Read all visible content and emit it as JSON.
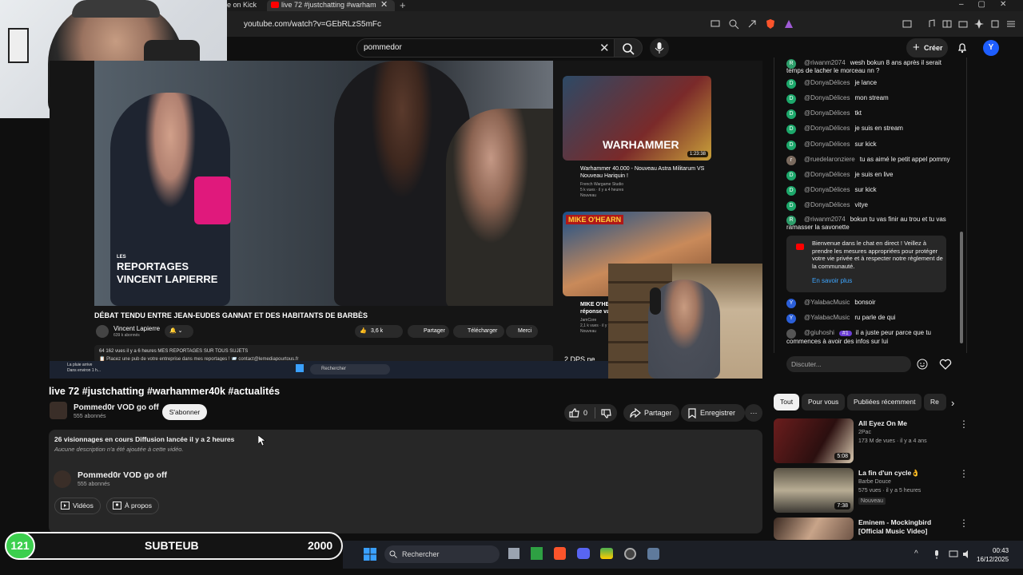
{
  "browser": {
    "prev_tab": "e on Kick",
    "active_tab": "live 72 #justchatting #warham",
    "url": "youtube.com/watch?v=GEbRLzS5mFc"
  },
  "topbar": {
    "search_value": "pommedor",
    "create_label": "Créer",
    "avatar_letter": "Y"
  },
  "player_frame": {
    "title": "DÉBAT TENDU ENTRE JEAN-EUDES GANNAT ET DES HABITANTS DE BARBÈS",
    "watermark_line1": "LES",
    "watermark_line2": "REPORTAGES",
    "watermark_line3": "VINCENT LAPIERRE",
    "channel": "Vincent Lapierre",
    "channel_subs": "639 k abonnés",
    "likes": "3,6 k",
    "share": "Partager",
    "download": "Télécharger",
    "thanks": "Merci",
    "desc_line1": "64 162 vues  il y a 6 heures  MES REPORTAGES SUR TOUS SUJETS",
    "desc_line2": "📋 Placez une pub de votre entreprise dans mes reportages ! 📨 contact@lemediapourtous.fr",
    "rec1_title": "Warhammer 40.000 - Nouveau Astra Militarum VS Nouveau Hariquin !",
    "rec1_channel": "French Wargame Studio",
    "rec1_meta": "5 k vues · il y a 4 heures",
    "rec1_badge": "Nouveau",
    "rec1_duration": "1:23:38",
    "rec1_banner": "WARHAMMER",
    "rec2_banner": "MIKE O'HEARN",
    "rec2_title": "MIKE O'HE",
    "rec2_sub": "réponse va",
    "rec2_channel": "JamCore",
    "rec2_meta": "2,1 k vues · il y a",
    "rec2_badge": "Nouveau",
    "rec3_title": "2 DPS ne",
    "taskbar_search": "Rechercher",
    "weather1": "La pluie arrive",
    "weather2": "Dans environ 1 h..."
  },
  "video": {
    "title": "live 72 #justchatting #warhammer40k #actualités",
    "channel_name": "Pommed0r VOD go off",
    "subscribers": "555 abonnés",
    "subscribe_label": "S'abonner",
    "likes": "0",
    "share_label": "Partager",
    "save_label": "Enregistrer",
    "more_label": "···"
  },
  "description": {
    "views_line": "26 visionnages en cours  Diffusion lancée il y a 2 heures",
    "empty_text": "Aucune description n'a été ajoutée à cette vidéo.",
    "channel_name": "Pommed0r VOD go off",
    "subscribers": "555 abonnés",
    "videos_btn": "Vidéos",
    "about_btn": "À propos"
  },
  "chat": {
    "messages": [
      {
        "initial": "R",
        "color": "#2e9e6b",
        "user": "@riwanm2074",
        "text": "wesh bokun 8 ans après il serait temps de lacher le morceau nn ?"
      },
      {
        "initial": "D",
        "color": "#1da86b",
        "user": "@DonyaDélices",
        "text": "je lance"
      },
      {
        "initial": "D",
        "color": "#1da86b",
        "user": "@DonyaDélices",
        "text": "mon stream"
      },
      {
        "initial": "D",
        "color": "#1da86b",
        "user": "@DonyaDélices",
        "text": "tkt"
      },
      {
        "initial": "D",
        "color": "#1da86b",
        "user": "@DonyaDélices",
        "text": "je suis en stream"
      },
      {
        "initial": "D",
        "color": "#1da86b",
        "user": "@DonyaDélices",
        "text": "sur kick"
      },
      {
        "initial": "r",
        "color": "#7a6a5e",
        "user": "@ruedelaronziere",
        "text": "tu as aimé le petit appel pommy"
      },
      {
        "initial": "D",
        "color": "#1da86b",
        "user": "@DonyaDélices",
        "text": "je suis en live"
      },
      {
        "initial": "D",
        "color": "#1da86b",
        "user": "@DonyaDélices",
        "text": "sur kick"
      },
      {
        "initial": "D",
        "color": "#1da86b",
        "user": "@DonyaDélices",
        "text": "vityе"
      },
      {
        "initial": "R",
        "color": "#2e9e6b",
        "user": "@riwanm2074",
        "text": "bokun tu vas finir au trou et tu vas ramasser la savonette"
      }
    ],
    "notice": "Bienvenue dans le chat en direct ! Veillez à prendre les mesures appropriées pour protéger votre vie privée et à respecter notre règlement de la communauté.",
    "notice_link": "En savoir plus",
    "messages2": [
      {
        "initial": "Y",
        "color": "#2b5fd9",
        "user": "@YalabacMusic",
        "text": "bonsoir"
      },
      {
        "initial": "Y",
        "color": "#2b5fd9",
        "user": "@YalabacMusic",
        "text": "ru parle de qui"
      },
      {
        "initial": "",
        "color": "#555555",
        "user": "@giuhoshi",
        "badge": "#1",
        "text": "il a juste peur parce que tu commences à avoir des infos sur lui"
      }
    ],
    "input_placeholder": "Discuter..."
  },
  "chips": [
    "Tout",
    "Pour vous",
    "Publiées récemment",
    "Re"
  ],
  "recommendations": [
    {
      "title": "All Eyez On Me",
      "channel": "2Pac",
      "meta": "173 M de vues · il y a 4 ans",
      "duration": "5:08",
      "badge": ""
    },
    {
      "title": "La fin d'un cycle👌",
      "channel": "Barbe Douce",
      "meta": "575 vues · il y a 5 heures",
      "duration": "7:38",
      "badge": "Nouveau"
    },
    {
      "title": "Eminem - Mockingbird [Official Music Video]",
      "channel": "",
      "meta": "",
      "duration": "",
      "badge": ""
    }
  ],
  "goal": {
    "count": "121",
    "label": "SUBTEUB",
    "target": "2000"
  },
  "taskbar": {
    "search": "Rechercher",
    "time": "00:43",
    "date": "16/12/2025"
  }
}
